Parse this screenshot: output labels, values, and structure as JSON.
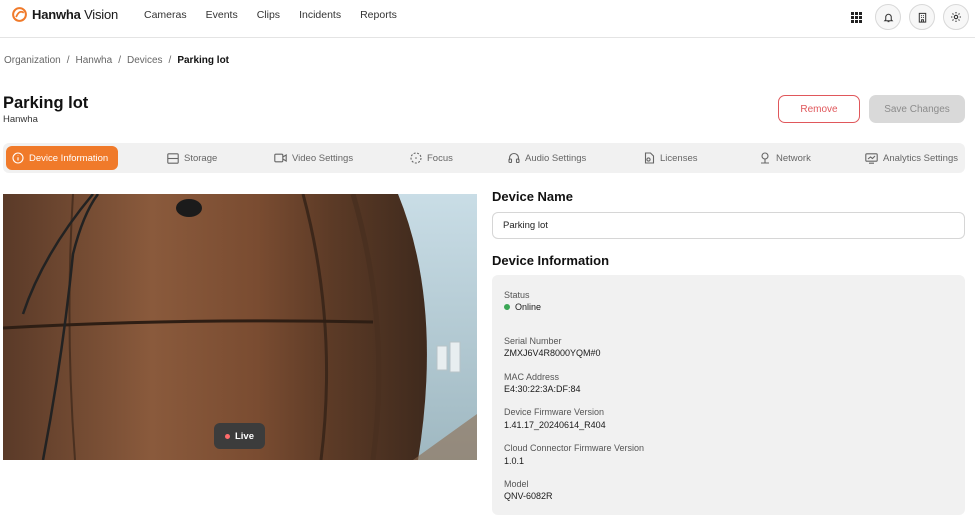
{
  "brand": {
    "name_bold": "Hanwha",
    "name_light": " Vision",
    "accent": "#f07a2a"
  },
  "nav": [
    "Cameras",
    "Events",
    "Clips",
    "Incidents",
    "Reports"
  ],
  "topbar_icons": [
    "apps-grid-icon",
    "bell-icon",
    "building-icon",
    "gear-icon"
  ],
  "breadcrumb": [
    "Organization",
    "Hanwha",
    "Devices",
    "Parking lot"
  ],
  "page": {
    "title": "Parking lot",
    "subtitle": "Hanwha"
  },
  "actions": {
    "remove_label": "Remove",
    "save_label": "Save Changes",
    "remove_color": "#e0575b"
  },
  "tabs": [
    {
      "label": "Device Information",
      "icon": "info-icon",
      "active": true
    },
    {
      "label": "Storage",
      "icon": "storage-icon",
      "active": false
    },
    {
      "label": "Video Settings",
      "icon": "video-icon",
      "active": false
    },
    {
      "label": "Focus",
      "icon": "focus-icon",
      "active": false
    },
    {
      "label": "Audio Settings",
      "icon": "headphones-icon",
      "active": false
    },
    {
      "label": "Licenses",
      "icon": "license-icon",
      "active": false
    },
    {
      "label": "Network",
      "icon": "network-icon",
      "active": false
    },
    {
      "label": "Analytics Settings",
      "icon": "analytics-icon",
      "active": false
    }
  ],
  "camera": {
    "live_label": "Live"
  },
  "device_name": {
    "title": "Device Name",
    "value": "Parking lot"
  },
  "device_info": {
    "title": "Device Information",
    "status_label": "Status",
    "status_value": "Online",
    "status_color": "#3aa655",
    "fields": [
      {
        "label": "Serial Number",
        "value": "ZMXJ6V4R8000YQM#0"
      },
      {
        "label": "MAC Address",
        "value": "E4:30:22:3A:DF:84"
      },
      {
        "label": "Device Firmware Version",
        "value": "1.41.17_20240614_R404"
      },
      {
        "label": "Cloud Connector Firmware Version",
        "value": "1.0.1"
      },
      {
        "label": "Model",
        "value": "QNV-6082R"
      }
    ]
  }
}
